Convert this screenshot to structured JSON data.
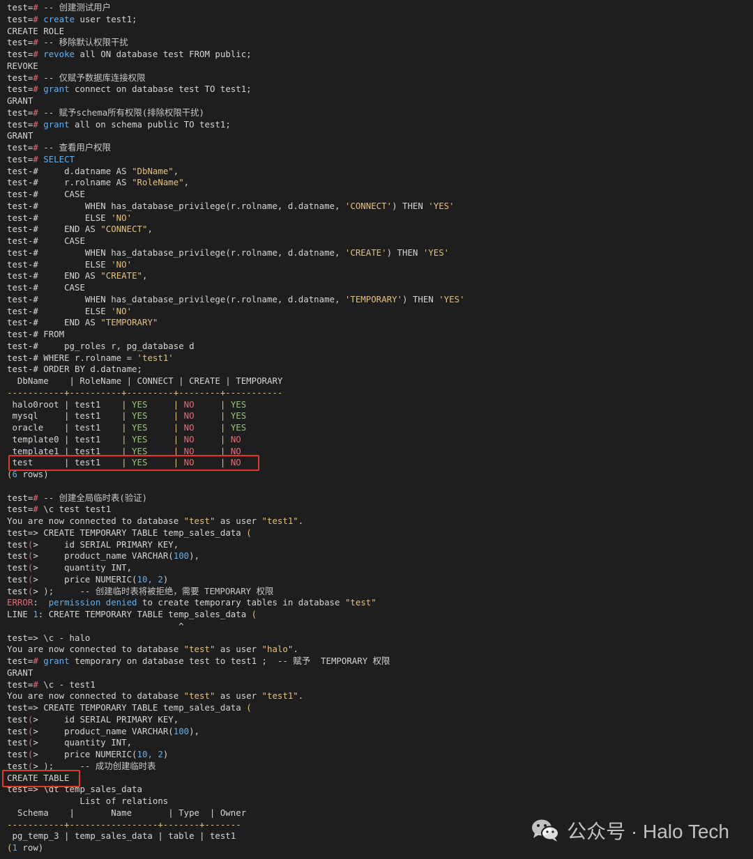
{
  "terminal": {
    "lines": [
      [
        {
          "t": "test=",
          "c": "p"
        },
        {
          "t": "#",
          "c": "op"
        },
        {
          "t": " -- 创建测试用户",
          "c": "cm"
        }
      ],
      [
        {
          "t": "test=",
          "c": "p"
        },
        {
          "t": "#",
          "c": "op"
        },
        {
          "t": " create",
          "c": "kw"
        },
        {
          "t": " user test1;"
        }
      ],
      [
        {
          "t": "CREATE ROLE"
        }
      ],
      [
        {
          "t": "test=",
          "c": "p"
        },
        {
          "t": "#",
          "c": "op"
        },
        {
          "t": " -- 移除默认权限干扰",
          "c": "cm"
        }
      ],
      [
        {
          "t": "test=",
          "c": "p"
        },
        {
          "t": "#",
          "c": "op"
        },
        {
          "t": " revoke",
          "c": "kw"
        },
        {
          "t": " all ON database test FROM public;"
        }
      ],
      [
        {
          "t": "REVOKE"
        }
      ],
      [
        {
          "t": "test=",
          "c": "p"
        },
        {
          "t": "#",
          "c": "op"
        },
        {
          "t": " -- 仅赋予数据库连接权限",
          "c": "cm"
        }
      ],
      [
        {
          "t": "test=",
          "c": "p"
        },
        {
          "t": "#",
          "c": "op"
        },
        {
          "t": " grant",
          "c": "kw"
        },
        {
          "t": " connect on database test TO test1;"
        }
      ],
      [
        {
          "t": "GRANT"
        }
      ],
      [
        {
          "t": "test=",
          "c": "p"
        },
        {
          "t": "#",
          "c": "op"
        },
        {
          "t": " -- 赋予schema所有权限(排除权限干扰)",
          "c": "cm"
        }
      ],
      [
        {
          "t": "test=",
          "c": "p"
        },
        {
          "t": "#",
          "c": "op"
        },
        {
          "t": " grant",
          "c": "kw"
        },
        {
          "t": " all on schema public TO test1;"
        }
      ],
      [
        {
          "t": "GRANT"
        }
      ],
      [
        {
          "t": "test=",
          "c": "p"
        },
        {
          "t": "#",
          "c": "op"
        },
        {
          "t": " -- 查看用户权限",
          "c": "cm"
        }
      ],
      [
        {
          "t": "test=",
          "c": "p"
        },
        {
          "t": "#",
          "c": "op"
        },
        {
          "t": " SELECT",
          "c": "kw"
        }
      ],
      [
        {
          "t": "test-",
          "c": "p"
        },
        {
          "t": "#",
          "c": "p"
        },
        {
          "t": "     d.datname AS "
        },
        {
          "t": "\"DbName\"",
          "c": "str"
        },
        {
          "t": ","
        }
      ],
      [
        {
          "t": "test-",
          "c": "p"
        },
        {
          "t": "#",
          "c": "p"
        },
        {
          "t": "     r.rolname AS "
        },
        {
          "t": "\"RoleName\"",
          "c": "str"
        },
        {
          "t": ","
        }
      ],
      [
        {
          "t": "test-",
          "c": "p"
        },
        {
          "t": "#",
          "c": "p"
        },
        {
          "t": "     CASE"
        }
      ],
      [
        {
          "t": "test-",
          "c": "p"
        },
        {
          "t": "#",
          "c": "p"
        },
        {
          "t": "         WHEN has_database_privilege(r.rolname, d.datname, "
        },
        {
          "t": "'CONNECT'",
          "c": "str"
        },
        {
          "t": ") THEN "
        },
        {
          "t": "'YES'",
          "c": "str"
        }
      ],
      [
        {
          "t": "test-",
          "c": "p"
        },
        {
          "t": "#",
          "c": "p"
        },
        {
          "t": "         ELSE "
        },
        {
          "t": "'NO'",
          "c": "str"
        }
      ],
      [
        {
          "t": "test-",
          "c": "p"
        },
        {
          "t": "#",
          "c": "p"
        },
        {
          "t": "     END AS "
        },
        {
          "t": "\"CONNECT\"",
          "c": "str"
        },
        {
          "t": ","
        }
      ],
      [
        {
          "t": "test-",
          "c": "p"
        },
        {
          "t": "#",
          "c": "p"
        },
        {
          "t": "     CASE"
        }
      ],
      [
        {
          "t": "test-",
          "c": "p"
        },
        {
          "t": "#",
          "c": "p"
        },
        {
          "t": "         WHEN has_database_privilege(r.rolname, d.datname, "
        },
        {
          "t": "'CREATE'",
          "c": "str"
        },
        {
          "t": ") THEN "
        },
        {
          "t": "'YES'",
          "c": "str"
        }
      ],
      [
        {
          "t": "test-",
          "c": "p"
        },
        {
          "t": "#",
          "c": "p"
        },
        {
          "t": "         ELSE "
        },
        {
          "t": "'NO'",
          "c": "str"
        }
      ],
      [
        {
          "t": "test-",
          "c": "p"
        },
        {
          "t": "#",
          "c": "p"
        },
        {
          "t": "     END AS "
        },
        {
          "t": "\"CREATE\"",
          "c": "str"
        },
        {
          "t": ","
        }
      ],
      [
        {
          "t": "test-",
          "c": "p"
        },
        {
          "t": "#",
          "c": "p"
        },
        {
          "t": "     CASE"
        }
      ],
      [
        {
          "t": "test-",
          "c": "p"
        },
        {
          "t": "#",
          "c": "p"
        },
        {
          "t": "         WHEN has_database_privilege(r.rolname, d.datname, "
        },
        {
          "t": "'TEMPORARY'",
          "c": "str"
        },
        {
          "t": ") THEN "
        },
        {
          "t": "'YES'",
          "c": "str"
        }
      ],
      [
        {
          "t": "test-",
          "c": "p"
        },
        {
          "t": "#",
          "c": "p"
        },
        {
          "t": "         ELSE "
        },
        {
          "t": "'NO'",
          "c": "str"
        }
      ],
      [
        {
          "t": "test-",
          "c": "p"
        },
        {
          "t": "#",
          "c": "p"
        },
        {
          "t": "     END AS "
        },
        {
          "t": "\"TEMPORARY\"",
          "c": "str"
        }
      ],
      [
        {
          "t": "test-",
          "c": "p"
        },
        {
          "t": "#",
          "c": "p"
        },
        {
          "t": " FROM"
        }
      ],
      [
        {
          "t": "test-",
          "c": "p"
        },
        {
          "t": "#",
          "c": "p"
        },
        {
          "t": "     pg_roles r, pg_database d"
        }
      ],
      [
        {
          "t": "test-",
          "c": "p"
        },
        {
          "t": "#",
          "c": "p"
        },
        {
          "t": " WHERE r.rolname = "
        },
        {
          "t": "'test1'",
          "c": "str"
        }
      ],
      [
        {
          "t": "test-",
          "c": "p"
        },
        {
          "t": "#",
          "c": "p"
        },
        {
          "t": " ORDER BY d.datname;"
        }
      ],
      [
        {
          "t": "  DbName    | RoleName | CONNECT | CREATE | TEMPORARY"
        }
      ],
      [
        {
          "t": "-----------+----------+---------+--------+-----------",
          "c": "sep"
        }
      ],
      [
        {
          "t": " halo0root | test1    "
        },
        {
          "t": "| ",
          "c": "sep"
        },
        {
          "t": "YES",
          "c": "yes"
        },
        {
          "t": "     "
        },
        {
          "t": "| ",
          "c": "sep"
        },
        {
          "t": "NO",
          "c": "no"
        },
        {
          "t": "     "
        },
        {
          "t": "| ",
          "c": "sep"
        },
        {
          "t": "YES",
          "c": "yes"
        }
      ],
      [
        {
          "t": " mysql     | test1    "
        },
        {
          "t": "| ",
          "c": "sep"
        },
        {
          "t": "YES",
          "c": "yes"
        },
        {
          "t": "     "
        },
        {
          "t": "| ",
          "c": "sep"
        },
        {
          "t": "NO",
          "c": "no"
        },
        {
          "t": "     "
        },
        {
          "t": "| ",
          "c": "sep"
        },
        {
          "t": "YES",
          "c": "yes"
        }
      ],
      [
        {
          "t": " oracle    | test1    "
        },
        {
          "t": "| ",
          "c": "sep"
        },
        {
          "t": "YES",
          "c": "yes"
        },
        {
          "t": "     "
        },
        {
          "t": "| ",
          "c": "sep"
        },
        {
          "t": "NO",
          "c": "no"
        },
        {
          "t": "     "
        },
        {
          "t": "| ",
          "c": "sep"
        },
        {
          "t": "YES",
          "c": "yes"
        }
      ],
      [
        {
          "t": " template0 | test1    "
        },
        {
          "t": "| ",
          "c": "sep"
        },
        {
          "t": "YES",
          "c": "yes"
        },
        {
          "t": "     "
        },
        {
          "t": "| ",
          "c": "sep"
        },
        {
          "t": "NO",
          "c": "no"
        },
        {
          "t": "     "
        },
        {
          "t": "| ",
          "c": "sep"
        },
        {
          "t": "NO",
          "c": "no"
        }
      ],
      [
        {
          "t": " template1 | test1    "
        },
        {
          "t": "| ",
          "c": "sep"
        },
        {
          "t": "YES",
          "c": "yes"
        },
        {
          "t": "     "
        },
        {
          "t": "| ",
          "c": "sep"
        },
        {
          "t": "NO",
          "c": "no"
        },
        {
          "t": "     "
        },
        {
          "t": "| ",
          "c": "sep"
        },
        {
          "t": "NO",
          "c": "no"
        }
      ],
      [
        {
          "t": " test      | test1    "
        },
        {
          "t": "| ",
          "c": "sep"
        },
        {
          "t": "YES",
          "c": "yes"
        },
        {
          "t": "     "
        },
        {
          "t": "| ",
          "c": "sep"
        },
        {
          "t": "NO",
          "c": "no"
        },
        {
          "t": "     "
        },
        {
          "t": "| ",
          "c": "sep"
        },
        {
          "t": "NO",
          "c": "no"
        }
      ],
      [
        {
          "t": "(",
          "c": "sep"
        },
        {
          "t": "6",
          "c": "num"
        },
        {
          "t": " rows)"
        }
      ],
      [
        {
          "t": ""
        }
      ],
      [
        {
          "t": "test=",
          "c": "p"
        },
        {
          "t": "#",
          "c": "op"
        },
        {
          "t": " -- 创建全局临时表(验证)",
          "c": "cm"
        }
      ],
      [
        {
          "t": "test=",
          "c": "p"
        },
        {
          "t": "#",
          "c": "op"
        },
        {
          "t": " \\c test test1"
        }
      ],
      [
        {
          "t": "You are now connected to database "
        },
        {
          "t": "\"test\"",
          "c": "str"
        },
        {
          "t": " as user "
        },
        {
          "t": "\"test1\"",
          "c": "str"
        },
        {
          "t": "."
        }
      ],
      [
        {
          "t": "test=",
          "c": "p"
        },
        {
          "t": ">",
          "c": "p"
        },
        {
          "t": " CREATE TEMPORARY TABLE temp_sales_data "
        },
        {
          "t": "(",
          "c": "sep"
        }
      ],
      [
        {
          "t": "test",
          "c": "p"
        },
        {
          "t": "(",
          "c": "op"
        },
        {
          "t": ">",
          "c": "p"
        },
        {
          "t": "     id SERIAL PRIMARY KEY,"
        }
      ],
      [
        {
          "t": "test",
          "c": "p"
        },
        {
          "t": "(",
          "c": "op"
        },
        {
          "t": ">",
          "c": "p"
        },
        {
          "t": "     product_name VARCHAR("
        },
        {
          "t": "100",
          "c": "num"
        },
        {
          "t": "),"
        }
      ],
      [
        {
          "t": "test",
          "c": "p"
        },
        {
          "t": "(",
          "c": "op"
        },
        {
          "t": ">",
          "c": "p"
        },
        {
          "t": "     quantity INT,"
        }
      ],
      [
        {
          "t": "test",
          "c": "p"
        },
        {
          "t": "(",
          "c": "op"
        },
        {
          "t": ">",
          "c": "p"
        },
        {
          "t": "     price NUMERIC("
        },
        {
          "t": "10, 2",
          "c": "num"
        },
        {
          "t": ")"
        }
      ],
      [
        {
          "t": "test",
          "c": "p"
        },
        {
          "t": "(",
          "c": "op"
        },
        {
          "t": ">",
          "c": "p"
        },
        {
          "t": " );     -- 创建临时表将被拒绝，需要 TEMPORARY 权限",
          "c": "cm"
        }
      ],
      [
        {
          "t": "ERROR",
          "c": "err"
        },
        {
          "t": ":  "
        },
        {
          "t": "permission denied",
          "c": "kw"
        },
        {
          "t": " to create temporary tables in database "
        },
        {
          "t": "\"test\"",
          "c": "str"
        }
      ],
      [
        {
          "t": "LINE "
        },
        {
          "t": "1",
          "c": "num"
        },
        {
          "t": ": CREATE TEMPORARY TABLE temp_sales_data "
        },
        {
          "t": "(",
          "c": "sep"
        }
      ],
      [
        {
          "t": "                                 ^"
        }
      ],
      [
        {
          "t": "test=",
          "c": "p"
        },
        {
          "t": ">",
          "c": "p"
        },
        {
          "t": " \\c - halo"
        }
      ],
      [
        {
          "t": "You are now connected to database "
        },
        {
          "t": "\"test\"",
          "c": "str"
        },
        {
          "t": " as user "
        },
        {
          "t": "\"halo\"",
          "c": "str"
        },
        {
          "t": "."
        }
      ],
      [
        {
          "t": "test=",
          "c": "p"
        },
        {
          "t": "#",
          "c": "op"
        },
        {
          "t": " grant",
          "c": "kw"
        },
        {
          "t": " temporary on database test to test1 ;  -- 赋予  TEMPORARY 权限"
        }
      ],
      [
        {
          "t": "GRANT"
        }
      ],
      [
        {
          "t": "test=",
          "c": "p"
        },
        {
          "t": "#",
          "c": "op"
        },
        {
          "t": " \\c - test1"
        }
      ],
      [
        {
          "t": "You are now connected to database "
        },
        {
          "t": "\"test\"",
          "c": "str"
        },
        {
          "t": " as user "
        },
        {
          "t": "\"test1\"",
          "c": "str"
        },
        {
          "t": "."
        }
      ],
      [
        {
          "t": "test=",
          "c": "p"
        },
        {
          "t": ">",
          "c": "p"
        },
        {
          "t": " CREATE TEMPORARY TABLE temp_sales_data "
        },
        {
          "t": "(",
          "c": "sep"
        }
      ],
      [
        {
          "t": "test",
          "c": "p"
        },
        {
          "t": "(",
          "c": "op"
        },
        {
          "t": ">",
          "c": "p"
        },
        {
          "t": "     id SERIAL PRIMARY KEY,"
        }
      ],
      [
        {
          "t": "test",
          "c": "p"
        },
        {
          "t": "(",
          "c": "op"
        },
        {
          "t": ">",
          "c": "p"
        },
        {
          "t": "     product_name VARCHAR("
        },
        {
          "t": "100",
          "c": "num"
        },
        {
          "t": "),"
        }
      ],
      [
        {
          "t": "test",
          "c": "p"
        },
        {
          "t": "(",
          "c": "op"
        },
        {
          "t": ">",
          "c": "p"
        },
        {
          "t": "     quantity INT,"
        }
      ],
      [
        {
          "t": "test",
          "c": "p"
        },
        {
          "t": "(",
          "c": "op"
        },
        {
          "t": ">",
          "c": "p"
        },
        {
          "t": "     price NUMERIC("
        },
        {
          "t": "10, 2",
          "c": "num"
        },
        {
          "t": ")"
        }
      ],
      [
        {
          "t": "test",
          "c": "p"
        },
        {
          "t": "(",
          "c": "op"
        },
        {
          "t": ">",
          "c": "p"
        },
        {
          "t": " );     -- 成功创建临时表",
          "c": "cm"
        }
      ],
      [
        {
          "t": "CREATE TABLE"
        }
      ],
      [
        {
          "t": "test=",
          "c": "p"
        },
        {
          "t": ">",
          "c": "p"
        },
        {
          "t": " \\dt temp_sales_data"
        }
      ],
      [
        {
          "t": "              List of relations"
        }
      ],
      [
        {
          "t": "  Schema    |       Name       | Type  | Owner"
        }
      ],
      [
        {
          "t": "-----------+-----------------+-------+-------",
          "c": "sep"
        }
      ],
      [
        {
          "t": " pg_temp_3 | temp_sales_data | table | test1"
        }
      ],
      [
        {
          "t": "(",
          "c": "sep"
        },
        {
          "t": "1",
          "c": "num"
        },
        {
          "t": " row)"
        }
      ]
    ]
  },
  "watermark": {
    "text": "公众号 · Halo Tech",
    "icon": "wechat-icon"
  },
  "colors": {
    "background": "#1e1e1e",
    "highlight_box": "#e0392f"
  }
}
